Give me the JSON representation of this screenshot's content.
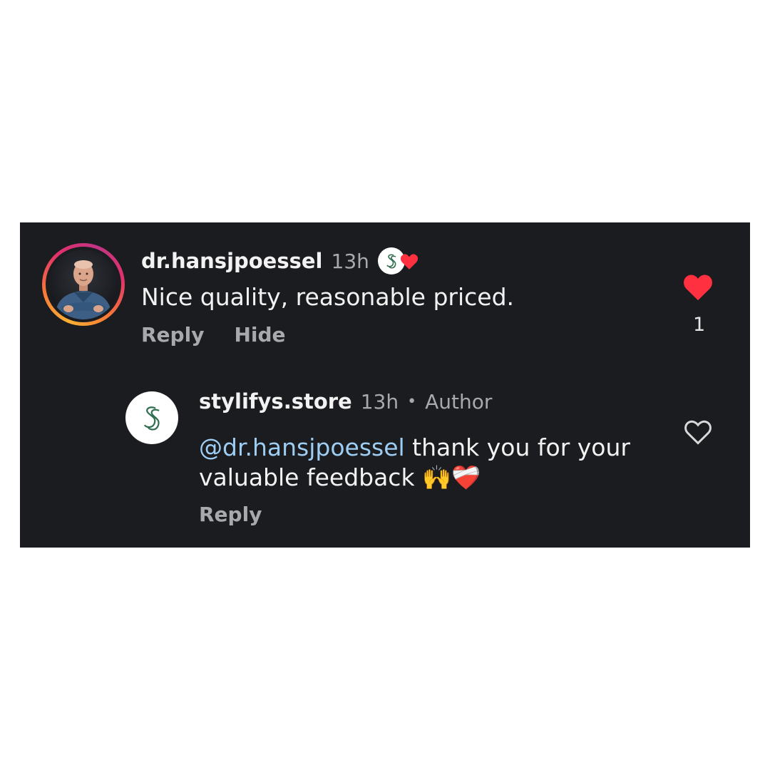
{
  "colors": {
    "panel_bg": "#1b1c20",
    "like_red": "#ff3040",
    "mention_blue": "#9ecdf3",
    "muted_text": "#a8a9ad",
    "brand_green": "#2f6e4f"
  },
  "comment": {
    "username": "dr.hansjpoessel",
    "time": "13h",
    "text": "Nice quality, reasonable priced.",
    "actions": {
      "reply": "Reply",
      "hide": "Hide"
    },
    "like_count": "1",
    "liked": true,
    "avatar_icon": "profile-photo",
    "creator_liked_icon": "brand-logo-with-heart"
  },
  "reply": {
    "username": "stylifys.store",
    "time": "13h",
    "separator": "•",
    "author_label": "Author",
    "mention": "@dr.hansjpoessel",
    "text_line1": " thank you for your",
    "text_line2": "valuable feedback",
    "emojis": "🙌❤️‍🩹",
    "actions": {
      "reply": "Reply"
    },
    "liked": false,
    "avatar_icon": "brand-logo"
  }
}
